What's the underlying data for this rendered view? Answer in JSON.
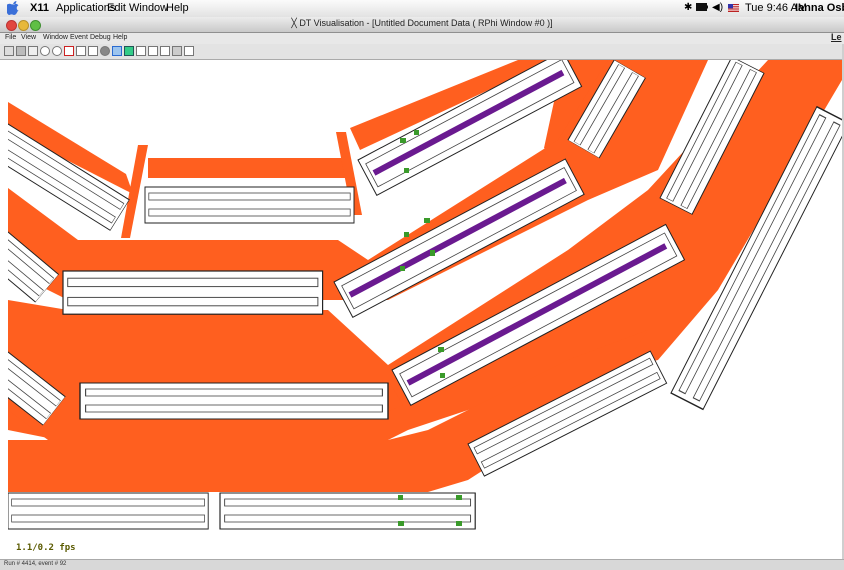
{
  "menubar": {
    "app_name": "X11",
    "items": [
      "Applications",
      "Edit",
      "Window",
      "Help"
    ],
    "clock": "Tue 9:46 AM",
    "user": "Ianna Osborne",
    "icons": [
      "apple-icon",
      "bluetooth-icon",
      "battery-icon",
      "volume-icon",
      "flag-icon"
    ]
  },
  "window": {
    "title": "DT Visualisation - [Untitled Document Data ( RPhi Window #0 )]",
    "right_tab": "Le"
  },
  "app_menu": {
    "items": [
      "File",
      "View",
      "Window",
      "Event",
      "Debug",
      "Help"
    ]
  },
  "toolbar": {
    "tools": [
      "save-icon",
      "print-icon",
      "grid-icon",
      "zoom-in-icon",
      "zoom-out-icon",
      "pick-icon",
      "rotate-icon",
      "pen-icon",
      "shade-icon",
      "select-icon",
      "color-icon",
      "track-icon",
      "track2-icon",
      "axis-icon",
      "camera-icon",
      "ruler-icon"
    ]
  },
  "viewport": {
    "fps": "1.1/0.2 fps"
  },
  "statusbar": {
    "text": "Run # 4414, event # 92"
  },
  "colors": {
    "orange": "#ff5f1f",
    "purple": "#6a1a90",
    "green": "#3a9a2a",
    "module_outline": "#222222"
  }
}
